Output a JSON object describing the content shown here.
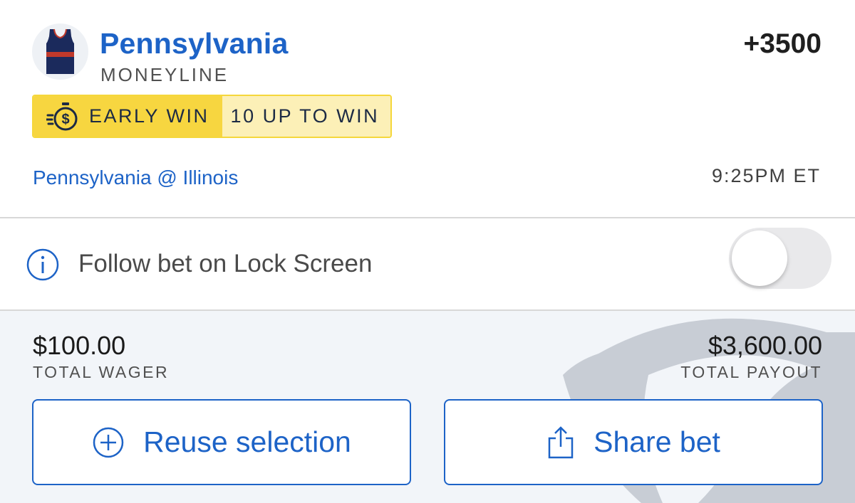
{
  "bet": {
    "team": "Pennsylvania",
    "market": "MONEYLINE",
    "odds": "+3500",
    "avatar_icon": "basketball-jersey-icon",
    "jersey_colors": {
      "body": "#1b2a5c",
      "stripe": "#c0392b"
    }
  },
  "badge": {
    "icon": "stopwatch-dollar-icon",
    "label": "EARLY WIN",
    "detail": "10 UP TO WIN",
    "colors": {
      "primary": "#f7d640",
      "secondary": "#fcf0b7"
    }
  },
  "game": {
    "matchup": "Pennsylvania @ Illinois",
    "time": "9:25PM ET"
  },
  "follow": {
    "icon": "info-icon",
    "label": "Follow bet on Lock Screen",
    "enabled": false
  },
  "summary": {
    "wager_amount": "$100.00",
    "wager_label": "TOTAL WAGER",
    "payout_amount": "$3,600.00",
    "payout_label": "TOTAL PAYOUT"
  },
  "actions": {
    "reuse_label": "Reuse selection",
    "reuse_icon": "plus-circle-icon",
    "share_label": "Share bet",
    "share_icon": "share-icon"
  },
  "colors": {
    "accent": "#1d63c7"
  }
}
